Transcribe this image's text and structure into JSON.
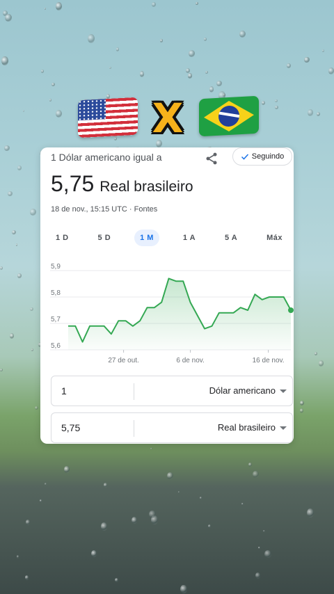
{
  "flags": {
    "left": "us-flag",
    "separator": "X",
    "right": "brazil-flag"
  },
  "card": {
    "header_label": "1 Dólar americano igual a",
    "follow_label": "Seguindo",
    "rate_value": "5,75",
    "rate_unit": "Real brasileiro",
    "timestamp": "18 de nov., 15:15 UTC · Fontes",
    "tabs": [
      "1 D",
      "5 D",
      "1 M",
      "1 A",
      "5 A",
      "Máx"
    ],
    "active_tab": "1 M"
  },
  "chart_data": {
    "type": "area",
    "y_ticks": [
      "5,9",
      "5,8",
      "5,7",
      "5,6"
    ],
    "x_ticks": [
      "27 de out.",
      "6 de nov.",
      "16 de nov."
    ],
    "ylim": [
      5.6,
      5.9
    ],
    "series_color": "#34a853",
    "values": [
      5.69,
      5.69,
      5.63,
      5.69,
      5.69,
      5.69,
      5.66,
      5.71,
      5.71,
      5.69,
      5.71,
      5.76,
      5.76,
      5.78,
      5.87,
      5.86,
      5.86,
      5.78,
      5.73,
      5.68,
      5.69,
      5.74,
      5.74,
      5.74,
      5.76,
      5.75,
      5.81,
      5.79,
      5.8,
      5.8,
      5.8,
      5.75
    ],
    "grid": true
  },
  "converter": {
    "from_amount": "1",
    "from_currency": "Dólar americano",
    "to_amount": "5,75",
    "to_currency": "Real brasileiro"
  }
}
